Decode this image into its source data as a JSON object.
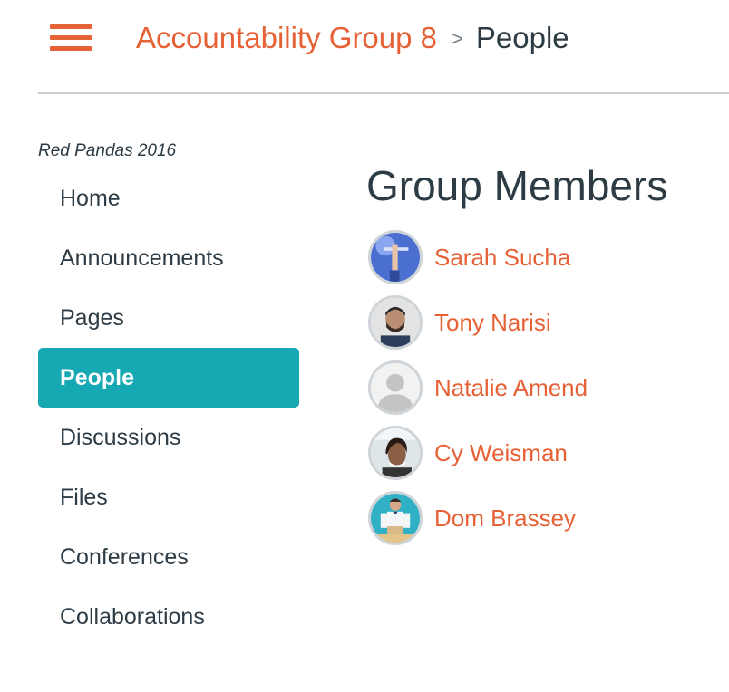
{
  "header": {
    "menu_icon": "hamburger-menu-icon",
    "breadcrumb": {
      "parent": "Accountability Group 8",
      "separator": ">",
      "current": "People"
    }
  },
  "sidebar": {
    "context_label": "Red Pandas 2016",
    "items": [
      {
        "label": "Home",
        "active": false
      },
      {
        "label": "Announcements",
        "active": false
      },
      {
        "label": "Pages",
        "active": false
      },
      {
        "label": "People",
        "active": true
      },
      {
        "label": "Discussions",
        "active": false
      },
      {
        "label": "Files",
        "active": false
      },
      {
        "label": "Conferences",
        "active": false
      },
      {
        "label": "Collaborations",
        "active": false
      }
    ]
  },
  "main": {
    "title": "Group Members",
    "members": [
      {
        "name": "Sarah Sucha"
      },
      {
        "name": "Tony Narisi"
      },
      {
        "name": "Natalie Amend"
      },
      {
        "name": "Cy Weisman"
      },
      {
        "name": "Dom Brassey"
      }
    ]
  },
  "colors": {
    "accent": "#e66135",
    "active_nav": "#16a9b3",
    "text": "#2d3b45",
    "divider": "#c7cdd1"
  }
}
